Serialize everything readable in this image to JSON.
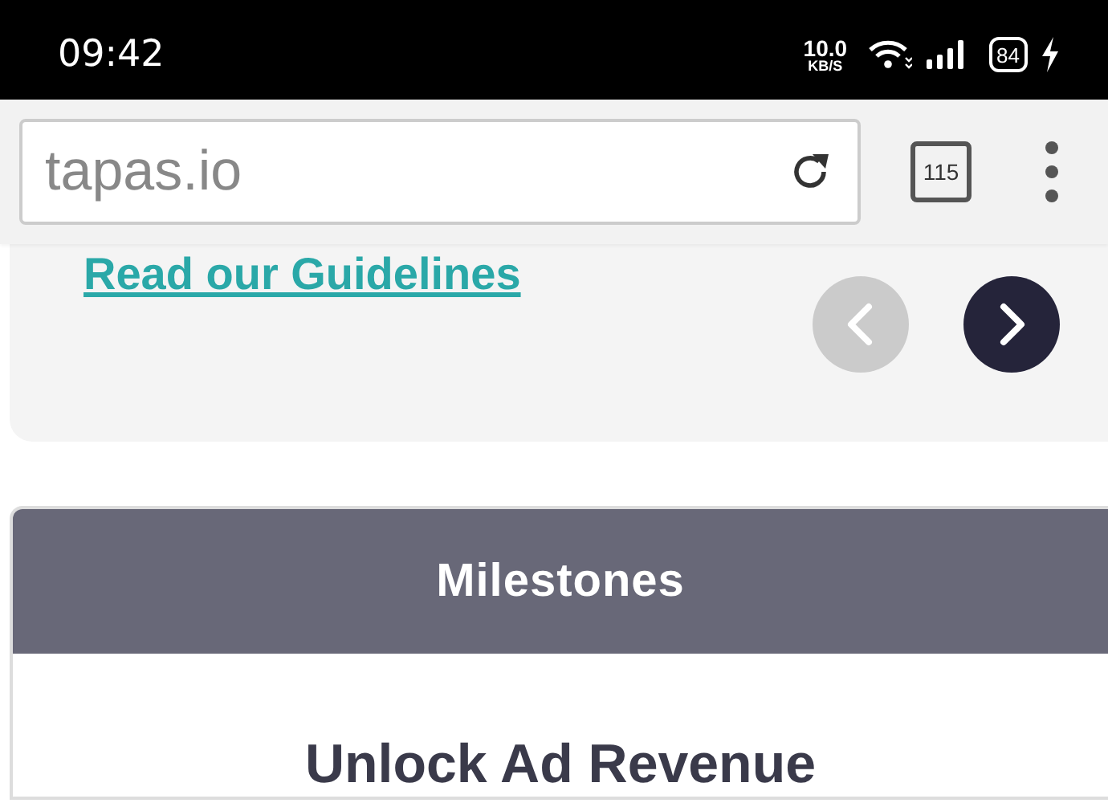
{
  "status_bar": {
    "time": "09:42",
    "net_speed": "10.0",
    "net_unit": "KB/S",
    "battery": "84",
    "charging": true
  },
  "browser": {
    "url": "tapas.io",
    "tab_count": "115"
  },
  "guidelines_card": {
    "link": "Read our Guidelines",
    "prev_disabled": true,
    "next_disabled": false
  },
  "milestones": {
    "header": "Milestones",
    "title": "Unlock Ad Revenue"
  }
}
